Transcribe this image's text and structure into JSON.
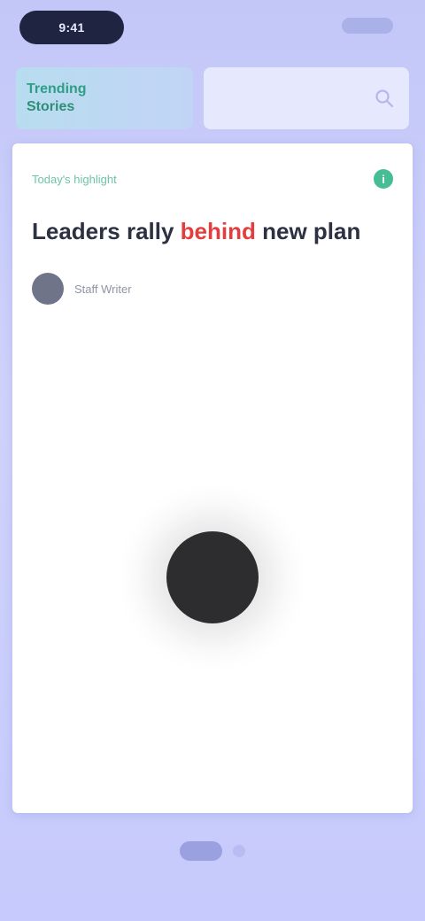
{
  "status": {
    "time": "9:41"
  },
  "header": {
    "brand_line1": "Trending",
    "brand_line2": "Stories",
    "search_placeholder": "",
    "search_icon": "search-icon"
  },
  "card": {
    "section_label": "Today's highlight",
    "info_icon": "info-icon",
    "headline_part1": "Leaders rally",
    "headline_accent": "behind",
    "headline_part2": "new plan",
    "author_name": "Staff Writer",
    "media_icon": "dark-ball"
  },
  "pager": {
    "active": 0,
    "count": 2
  },
  "colors": {
    "accent_green": "#2e9e86",
    "accent_red": "#e23e3e",
    "card_bg": "#ffffff",
    "page_bg": "#c9cdfb"
  }
}
